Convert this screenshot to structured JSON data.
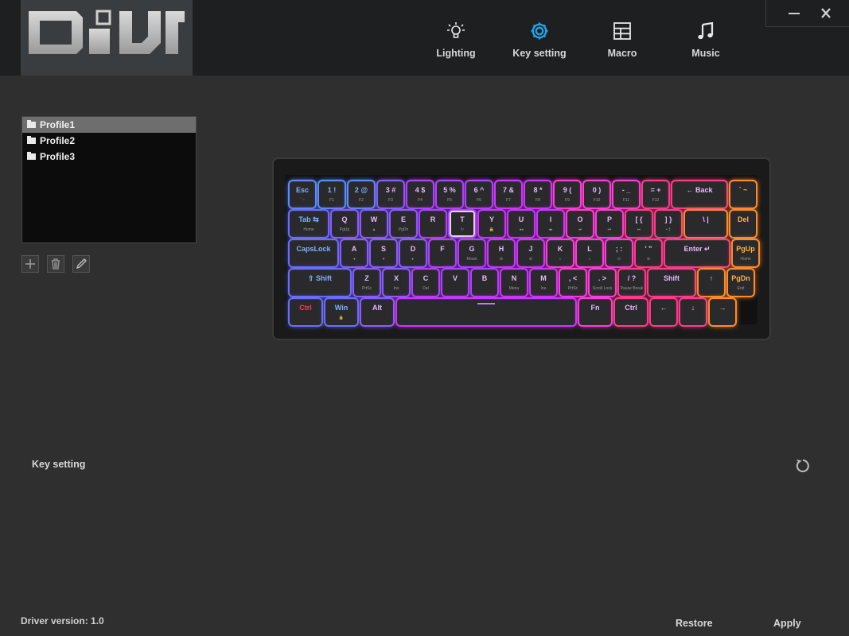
{
  "app": {
    "logo_text": "DIY"
  },
  "nav": [
    {
      "label": "Lighting",
      "icon": "bulb-icon",
      "active": false
    },
    {
      "label": "Key setting",
      "icon": "gear-icon",
      "active": true
    },
    {
      "label": "Macro",
      "icon": "grid-icon",
      "active": false
    },
    {
      "label": "Music",
      "icon": "music-note-icon",
      "active": false
    }
  ],
  "profiles": [
    {
      "label": "Profile1",
      "selected": true
    },
    {
      "label": "Profile2",
      "selected": false
    },
    {
      "label": "Profile3",
      "selected": false
    }
  ],
  "section_label": "Key setting",
  "driver_version": "Driver version: 1.0",
  "footer": {
    "restore": "Restore",
    "apply": "Apply"
  },
  "colors": {
    "accent": "#1fa3e5",
    "background": "#2f2f2f",
    "header": "#1e1f21"
  },
  "keyboard": {
    "rows": [
      [
        {
          "a": "Esc",
          "b": "` ~"
        },
        {
          "a": "1 !",
          "b": "F1"
        },
        {
          "a": "2 @",
          "b": "F2"
        },
        {
          "a": "3 #",
          "b": "F3"
        },
        {
          "a": "4 $",
          "b": "F4"
        },
        {
          "a": "5 %",
          "b": "F5"
        },
        {
          "a": "6 ^",
          "b": "F6"
        },
        {
          "a": "7 &",
          "b": "F7"
        },
        {
          "a": "8 *",
          "b": "F8"
        },
        {
          "a": "9 (",
          "b": "F9"
        },
        {
          "a": "0 )",
          "b": "F10"
        },
        {
          "a": "- _",
          "b": "F11"
        },
        {
          "a": "= +",
          "b": "F12"
        },
        {
          "a": "← Back",
          "b": ""
        },
        {
          "a": "` ~",
          "b": ""
        }
      ],
      [
        {
          "a": "Tab ⇆",
          "b": "Home"
        },
        {
          "a": "Q",
          "b": "PgUp"
        },
        {
          "a": "W",
          "b": "▲"
        },
        {
          "a": "E",
          "b": "PgDn"
        },
        {
          "a": "R",
          "b": ""
        },
        {
          "a": "T",
          "b": "↻"
        },
        {
          "a": "Y",
          "b": "🔒"
        },
        {
          "a": "U",
          "b": "◂◂"
        },
        {
          "a": "I",
          "b": "◂▸"
        },
        {
          "a": "O",
          "b": "◂•"
        },
        {
          "a": "P",
          "b": "⏮"
        },
        {
          "a": "[ {",
          "b": "⏭"
        },
        {
          "a": "] }",
          "b": "• ‡"
        },
        {
          "a": "\\ |",
          "b": ""
        },
        {
          "a": "Del",
          "b": ""
        }
      ],
      [
        {
          "a": "CapsLock",
          "b": ""
        },
        {
          "a": "A",
          "b": "◂"
        },
        {
          "a": "S",
          "b": "▾"
        },
        {
          "a": "D",
          "b": "▸"
        },
        {
          "a": "F",
          "b": ""
        },
        {
          "a": "G",
          "b": "Reset"
        },
        {
          "a": "H",
          "b": "⊘"
        },
        {
          "a": "J",
          "b": "⊘"
        },
        {
          "a": "K",
          "b": "☼"
        },
        {
          "a": "L",
          "b": "☼"
        },
        {
          "a": "; :",
          "b": "⊙"
        },
        {
          "a": "' \"",
          "b": "⊚"
        },
        {
          "a": "Enter ↵",
          "b": ""
        },
        {
          "a": "PgUp",
          "b": "Home"
        }
      ],
      [
        {
          "a": "⇧ Shift",
          "b": ""
        },
        {
          "a": "Z",
          "b": "PrtSc"
        },
        {
          "a": "X",
          "b": "Ins"
        },
        {
          "a": "C",
          "b": "Del"
        },
        {
          "a": "V",
          "b": ""
        },
        {
          "a": "B",
          "b": ""
        },
        {
          "a": "N",
          "b": "Menu"
        },
        {
          "a": "M",
          "b": "Ins"
        },
        {
          "a": ", <",
          "b": "PrtSc"
        },
        {
          "a": ". >",
          "b": "Scroll Lock"
        },
        {
          "a": "/ ?",
          "b": "Pause Break"
        },
        {
          "a": "Shift",
          "b": ""
        },
        {
          "a": "↑",
          "b": ""
        },
        {
          "a": "PgDn",
          "b": "End"
        }
      ],
      [
        {
          "a": "Ctrl",
          "b": ""
        },
        {
          "a": "Win",
          "b": "🔒"
        },
        {
          "a": "Alt",
          "b": ""
        },
        {
          "a": "",
          "b": ""
        },
        {
          "a": "Fn",
          "b": ""
        },
        {
          "a": "Ctrl",
          "b": ""
        },
        {
          "a": "←",
          "b": ""
        },
        {
          "a": "↓",
          "b": ""
        },
        {
          "a": "→",
          "b": ""
        }
      ]
    ]
  }
}
